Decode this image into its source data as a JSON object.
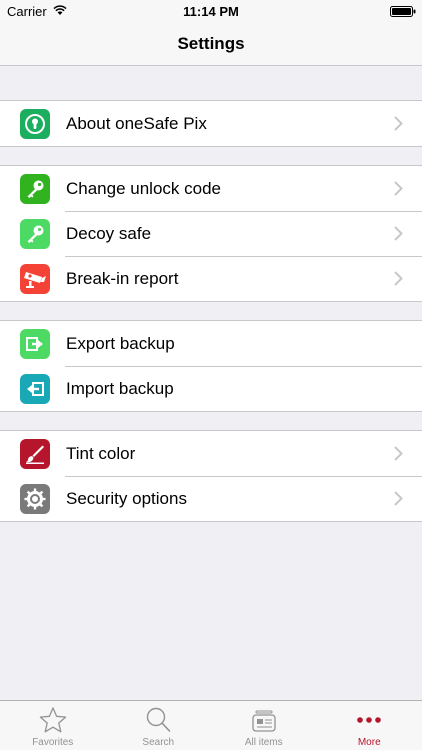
{
  "status_bar": {
    "carrier": "Carrier",
    "time": "11:14 PM"
  },
  "nav": {
    "title": "Settings"
  },
  "sections": [
    [
      {
        "label": "About oneSafe Pix",
        "icon": "keyhole-icon",
        "color": "#1cae5f",
        "chevron": true
      }
    ],
    [
      {
        "label": "Change unlock code",
        "icon": "key-icon",
        "color": "#31b31f",
        "chevron": true
      },
      {
        "label": "Decoy safe",
        "icon": "key-icon",
        "color": "#4cd964",
        "chevron": true
      },
      {
        "label": "Break-in report",
        "icon": "camera-icon",
        "color": "#f44336",
        "chevron": true
      }
    ],
    [
      {
        "label": "Export backup",
        "icon": "export-icon",
        "color": "#4cd964",
        "chevron": false
      },
      {
        "label": "Import backup",
        "icon": "import-icon",
        "color": "#18a8b6",
        "chevron": false
      }
    ],
    [
      {
        "label": "Tint color",
        "icon": "brush-icon",
        "color": "#b5162c",
        "chevron": true
      },
      {
        "label": "Security options",
        "icon": "gear-icon",
        "color": "#7a7a7a",
        "chevron": true
      }
    ]
  ],
  "tabs": [
    {
      "label": "Favorites",
      "icon": "star-icon",
      "active": false
    },
    {
      "label": "Search",
      "icon": "search-icon",
      "active": false
    },
    {
      "label": "All items",
      "icon": "items-icon",
      "active": false
    },
    {
      "label": "More",
      "icon": "more-icon",
      "active": true
    }
  ],
  "colors": {
    "accent": "#b5162c",
    "background": "#efeff4"
  }
}
